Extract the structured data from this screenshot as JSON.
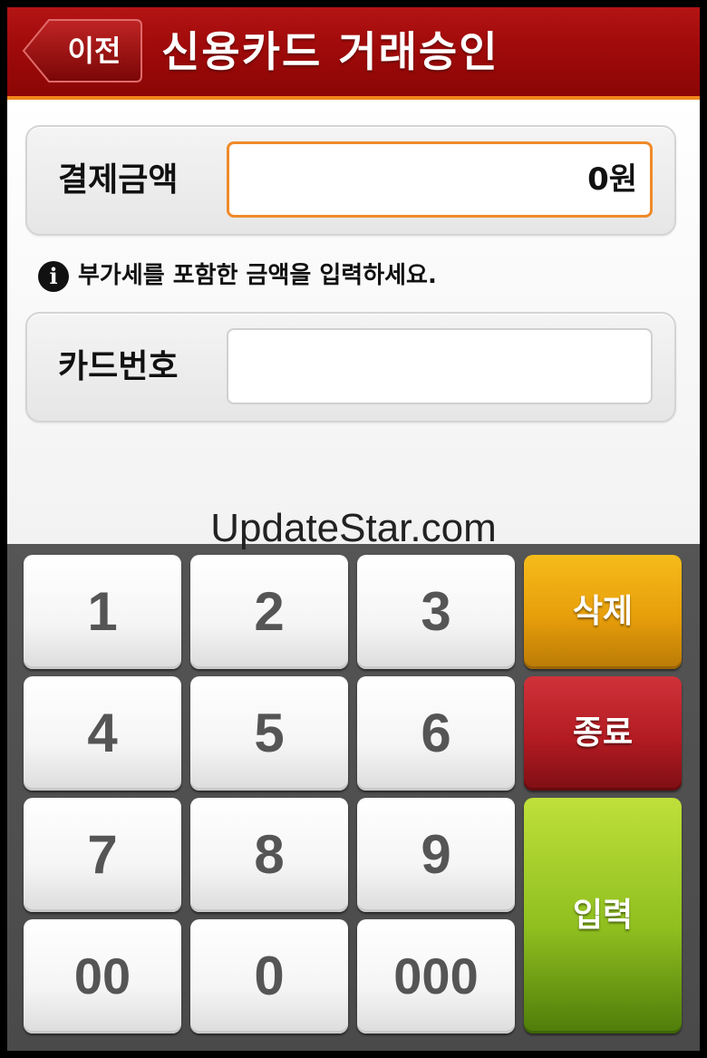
{
  "header": {
    "back_label": "이전",
    "title": "신용카드 거래승인"
  },
  "form": {
    "amount_label": "결제금액",
    "amount_value": "0원",
    "info_icon": "info-icon",
    "info_text": "부가세를 포함한 금액을 입력하세요.",
    "card_label": "카드번호",
    "card_value": ""
  },
  "watermark": "UpdateStar.com",
  "keypad": {
    "digits": [
      "1",
      "2",
      "3",
      "4",
      "5",
      "6",
      "7",
      "8",
      "9",
      "00",
      "0",
      "000"
    ],
    "delete_label": "삭제",
    "exit_label": "종료",
    "enter_label": "입력"
  },
  "colors": {
    "header": "#a00a0a",
    "accent_border": "#ef8a28",
    "delete": "#e79e0a",
    "exit": "#b31b22",
    "enter": "#8fbf1f"
  }
}
